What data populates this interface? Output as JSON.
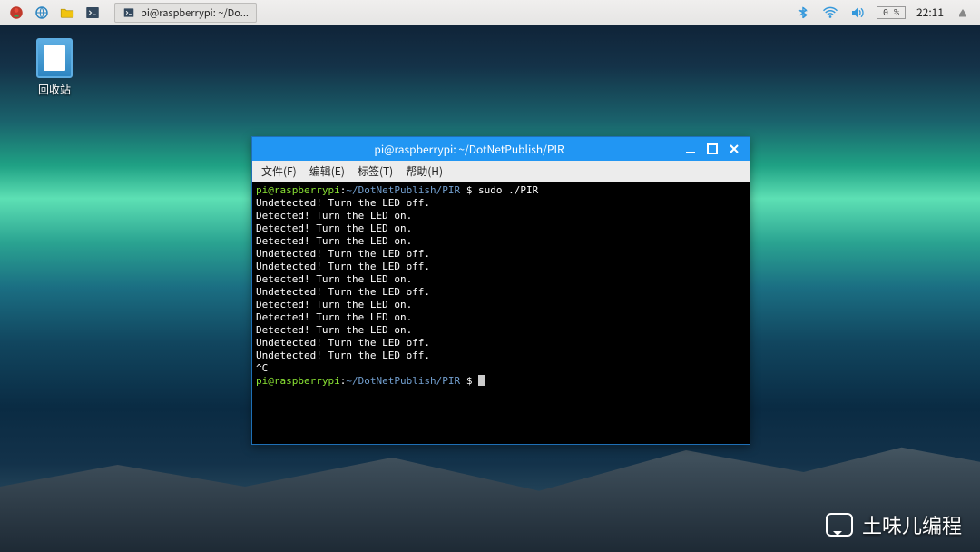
{
  "panel": {
    "taskbar_button": "pi@raspberrypi: ~/Do...",
    "cpu": "0 %",
    "clock": "22:11"
  },
  "desktop": {
    "trash_label": "回收站"
  },
  "terminal": {
    "title": "pi@raspberrypi: ~/DotNetPublish/PIR",
    "menu": {
      "file": "文件(F)",
      "edit": "编辑(E)",
      "tabs": "标签(T)",
      "help": "帮助(H)"
    },
    "prompt_user": "pi@raspberrypi",
    "prompt_path": "~/DotNetPublish/PIR",
    "prompt_dollar": "$",
    "command": "sudo ./PIR",
    "lines": [
      "Undetected! Turn the LED off.",
      "Detected! Turn the LED on.",
      "Detected! Turn the LED on.",
      "Detected! Turn the LED on.",
      "Undetected! Turn the LED off.",
      "Undetected! Turn the LED off.",
      "Detected! Turn the LED on.",
      "Undetected! Turn the LED off.",
      "Detected! Turn the LED on.",
      "Detected! Turn the LED on.",
      "Detected! Turn the LED on.",
      "Undetected! Turn the LED off.",
      "Undetected! Turn the LED off.",
      "^C"
    ]
  },
  "watermark": "土味儿编程"
}
